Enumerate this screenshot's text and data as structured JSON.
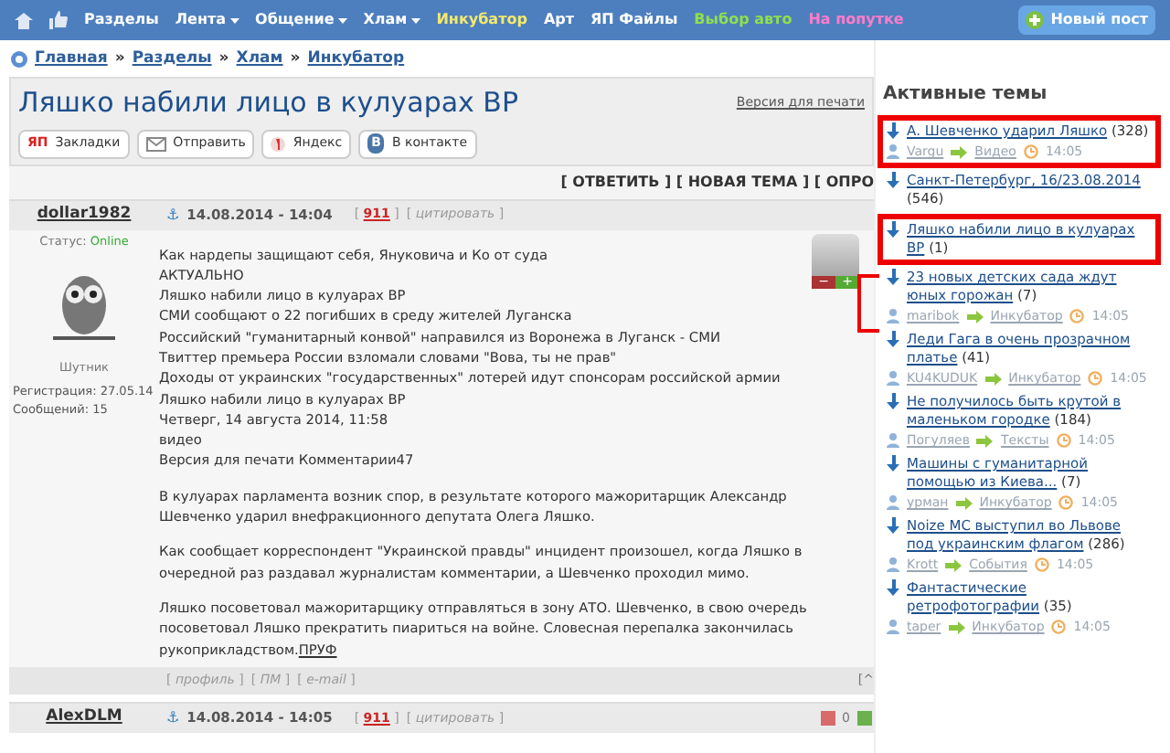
{
  "nav": {
    "items": [
      {
        "label": "Разделы",
        "color": "#ffffff",
        "dropdown": false
      },
      {
        "label": "Лента",
        "color": "#ffffff",
        "dropdown": true
      },
      {
        "label": "Общение",
        "color": "#ffffff",
        "dropdown": true
      },
      {
        "label": "Хлам",
        "color": "#ffffff",
        "dropdown": true
      },
      {
        "label": "Инкубатор",
        "color": "#f5e96a",
        "dropdown": false
      },
      {
        "label": "Арт",
        "color": "#ffffff",
        "dropdown": false
      },
      {
        "label": "ЯП Файлы",
        "color": "#ffffff",
        "dropdown": false
      },
      {
        "label": "Выбор авто",
        "color": "#8fe04a",
        "dropdown": false
      },
      {
        "label": "На попутке",
        "color": "#ff7ccb",
        "dropdown": false
      }
    ],
    "new_post": "Новый пост"
  },
  "breadcrumb": [
    "Главная",
    "Разделы",
    "Хлам",
    "Инкубатор"
  ],
  "breadcrumb_separator": "»",
  "topic": {
    "title": "Ляшко набили лицо в кулуарах ВР",
    "print_link": "Версия для печати",
    "share_buttons": [
      {
        "kind": "yap",
        "label": "Закладки",
        "badge": "ЯП"
      },
      {
        "kind": "mail",
        "label": "Отправить"
      },
      {
        "kind": "yandex",
        "label": "Яндекс"
      },
      {
        "kind": "vk",
        "label": "В контакте",
        "badge": "В"
      }
    ],
    "actions": "[ ОТВЕТИТЬ ] [ НОВАЯ ТЕМА ] [ ОПРО"
  },
  "posts": [
    {
      "author": "dollar1982",
      "anchor": "⚓",
      "date": "14.08.2014 - 14:04",
      "number": "[ **911** ]",
      "quote": "[ *цитировать* ]",
      "status_label": "Статус:",
      "status": "Online",
      "user_title": "Шутник",
      "registration": "Регистрация: 27.05.14",
      "messages": "Сообщений: 15",
      "vote_minus": "−",
      "vote_plus": "+",
      "paragraphs": [
        [
          "Как нардепы защищают себя, Януковича и Ко от суда",
          "АКТУАЛЬНО",
          "Ляшко набили лицо в кулуарах ВР",
          "СМИ сообщают о 22 погибших в среду жителей Луганска",
          "Российский \"гуманитарный конвой\" направился из Воронежа в Луганск - СМИ",
          "Твиттер премьера России взломали словами \"Вова, ты не прав\"",
          "Доходы от украинских \"государственных\" лотерей идут спонсорам российской армии",
          "Ляшко набили лицо в кулуарах ВР",
          "Четверг, 14 августа 2014, 11:58",
          "видео",
          "Версия для печати Комментарии47"
        ],
        [
          "В кулуарах парламента возник спор, в результате которого мажоритарщик Александр Шевченко ударил внефракционного депутата Олега Ляшко."
        ],
        [
          "Как сообщает корреспондент \"Украинской правды\" инцидент произошел, когда Ляшко в очередной раз раздавал журналистам комментарии, а Шевченко проходил мимо."
        ],
        [
          "Ляшко посоветовал мажоритарщику отправляться в зону АТО. Шевченко, в свою очередь посоветовал Ляшко прекратить пиариться на войне. Словесная перепалка закончилась рукоприкладством."
        ]
      ],
      "proof_link": "ПРУФ",
      "footer_links": [
        "[ *профиль* ]",
        "[ *ПМ* ]",
        "[ *e-mail* ]"
      ],
      "footer_right": "[^"
    },
    {
      "author": "AlexDLM",
      "anchor": "⚓",
      "date": "14.08.2014 - 14:05",
      "number": "[ **911** ]",
      "quote": "[ *цитировать* ]",
      "rating": "0"
    }
  ],
  "sidebar": {
    "title": "Активные темы",
    "topics": [
      {
        "title": "А. Шевченко ударил Ляшко",
        "count": "(328)",
        "highlighted": true,
        "meta": {
          "user": "Vargu",
          "section": "Видео",
          "time": "14:05"
        }
      },
      {
        "title": "Санкт-Петербург, 16/23.08.2014",
        "count": "(546)",
        "highlighted": false
      },
      {
        "title": "Ляшко набили лицо в кулуарах ВР",
        "count": "(1)",
        "highlighted": true
      },
      {
        "title": "23 новых детских сада ждут юных горожан",
        "count": "(7)",
        "highlighted": false,
        "meta": {
          "user": "maribok",
          "section": "Инкубатор",
          "time": "14:05"
        }
      },
      {
        "title": "Леди Гага в очень прозрачном платье",
        "count": "(41)",
        "highlighted": false,
        "meta": {
          "user": "KU4KUDUK",
          "section": "Инкубатор",
          "time": "14:05"
        }
      },
      {
        "title": "Не получилось быть крутой в маленьком городке",
        "count": "(184)",
        "highlighted": false,
        "meta": {
          "user": "Погуляев",
          "section": "Тексты",
          "time": "14:05"
        }
      },
      {
        "title": "Машины с гуманитарной помощью из Киева...",
        "count": "(7)",
        "highlighted": false,
        "meta": {
          "user": "урман",
          "section": "Инкубатор",
          "time": "14:05"
        }
      },
      {
        "title": "Noize MC выступил во Львове под украинским флагом",
        "count": "(286)",
        "highlighted": false,
        "meta": {
          "user": "Krott",
          "section": "События",
          "time": "14:05"
        }
      },
      {
        "title": "Фантастические ретрофотографии",
        "count": "(35)",
        "highlighted": false,
        "meta": {
          "user": "taper",
          "section": "Инкубатор",
          "time": "14:05"
        }
      }
    ]
  }
}
